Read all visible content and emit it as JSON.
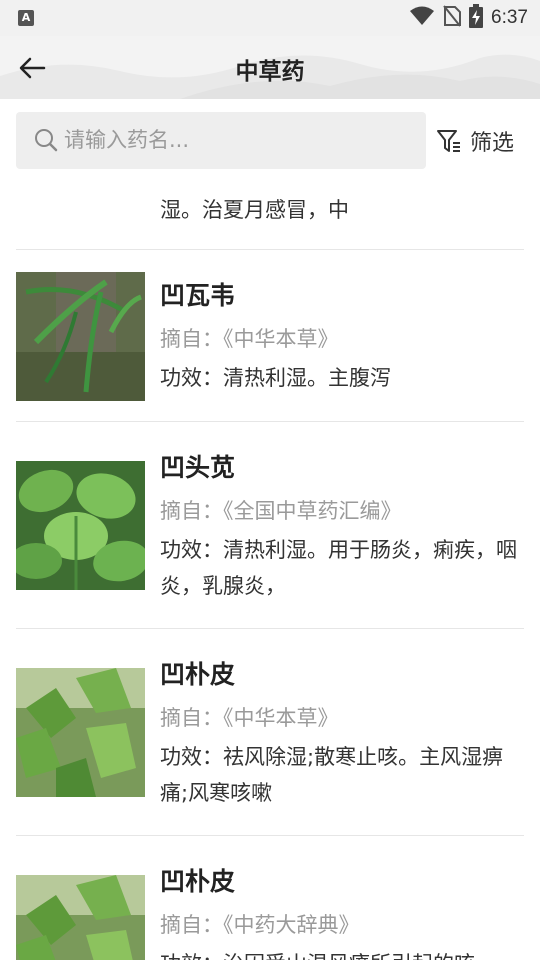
{
  "status_bar": {
    "app_icon_letter": "A",
    "time": "6:37"
  },
  "header": {
    "title": "中草药"
  },
  "search": {
    "placeholder": "请输入药名..."
  },
  "filter": {
    "label": "筛选"
  },
  "partial_item": {
    "effect": "湿。治夏月感冒，中"
  },
  "items": [
    {
      "name": "凹瓦韦",
      "source_prefix": "摘自：",
      "source": "《中华本草》",
      "effect_prefix": "功效：",
      "effect": "清热利湿。主腹泻"
    },
    {
      "name": "凹头苋",
      "source_prefix": "摘自：",
      "source": "《全国中草药汇编》",
      "effect_prefix": "功效：",
      "effect": "清热利湿。用于肠炎，痢疾，咽炎，乳腺炎，"
    },
    {
      "name": "凹朴皮",
      "source_prefix": "摘自：",
      "source": "《中华本草》",
      "effect_prefix": "功效：",
      "effect": "祛风除湿;散寒止咳。主风湿痹痛;风寒咳嗽"
    },
    {
      "name": "凹朴皮",
      "source_prefix": "摘自：",
      "source": "《中药大辞典》",
      "effect_prefix": "功效：",
      "effect": "治因受山温风瘴所引起的咳"
    }
  ],
  "colors": {
    "background": "#ffffff",
    "header_bg": "#f3f3f3",
    "search_bg": "#eeeeee",
    "muted_text": "#9a9a9a",
    "divider": "#e6e6e6"
  }
}
